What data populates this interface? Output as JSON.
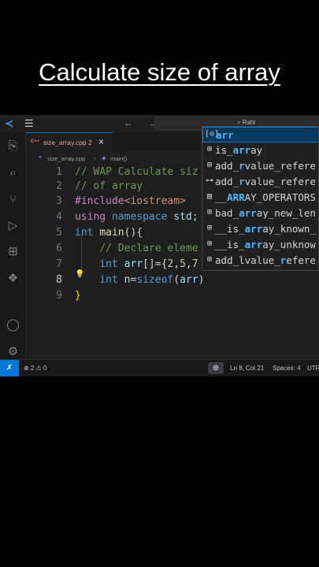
{
  "caption": "Calculate size of array",
  "titlebar": {
    "menu_icon": "☰",
    "search_text": "⌕ Rahi",
    "back_forward": "← →"
  },
  "activity_bar": [
    {
      "name": "explorer-icon",
      "glyph": "⎘"
    },
    {
      "name": "search-icon",
      "glyph": "⌕"
    },
    {
      "name": "source-control-icon",
      "glyph": "⑂"
    },
    {
      "name": "run-debug-icon",
      "glyph": "▷"
    },
    {
      "name": "extensions-icon",
      "glyph": "⊞"
    },
    {
      "name": "python-icon",
      "glyph": "❖"
    },
    {
      "name": "accounts-icon",
      "glyph": "◯"
    },
    {
      "name": "settings-gear-icon",
      "glyph": "⚙"
    }
  ],
  "tab": {
    "label": "size_array.cpp 2",
    "icon": "C++",
    "close": "×"
  },
  "breadcrumb": {
    "file": "size_array.cpp",
    "sep": "›",
    "symbol": "main()"
  },
  "code_lines": [
    {
      "n": "1",
      "parts": [
        {
          "t": "// WAP Calculate siz",
          "c": "cm"
        }
      ]
    },
    {
      "n": "2",
      "parts": [
        {
          "t": "// of array",
          "c": "cm"
        }
      ]
    },
    {
      "n": "3",
      "parts": [
        {
          "t": "#include",
          "c": "pp"
        },
        {
          "t": "<iostream>",
          "c": "inc"
        }
      ]
    },
    {
      "n": "4",
      "parts": [
        {
          "t": "using",
          "c": "pp"
        },
        {
          "t": " ",
          "c": "pl"
        },
        {
          "t": "namespace",
          "c": "kw"
        },
        {
          "t": " std;",
          "c": "id"
        }
      ]
    },
    {
      "n": "5",
      "parts": [
        {
          "t": "int",
          "c": "kw"
        },
        {
          "t": " ",
          "c": "pl"
        },
        {
          "t": "main",
          "c": "fn"
        },
        {
          "t": "(){",
          "c": "pl"
        }
      ]
    },
    {
      "n": "6",
      "parts": [
        {
          "t": "    ",
          "c": "pl"
        },
        {
          "t": "// Declare eleme",
          "c": "cm"
        }
      ]
    },
    {
      "n": "7",
      "parts": [
        {
          "t": "    ",
          "c": "pl"
        },
        {
          "t": "int",
          "c": "kw"
        },
        {
          "t": " ",
          "c": "pl"
        },
        {
          "t": "arr",
          "c": "id"
        },
        {
          "t": "[]={",
          "c": "pl"
        },
        {
          "t": "2",
          "c": "num"
        },
        {
          "t": ",",
          "c": "pl"
        },
        {
          "t": "5",
          "c": "num"
        },
        {
          "t": ",",
          "c": "pl"
        },
        {
          "t": "7",
          "c": "num"
        }
      ]
    },
    {
      "n": "8",
      "parts": [
        {
          "t": "    ",
          "c": "pl"
        },
        {
          "t": "int",
          "c": "kw"
        },
        {
          "t": " ",
          "c": "pl"
        },
        {
          "t": "n",
          "c": "id"
        },
        {
          "t": "=",
          "c": "pl"
        },
        {
          "t": "sizeof",
          "c": "kw"
        },
        {
          "t": "(",
          "c": "pl"
        },
        {
          "t": "arr",
          "c": "id"
        },
        {
          "t": ")",
          "c": "pl"
        }
      ]
    },
    {
      "n": "9",
      "parts": [
        {
          "t": "}",
          "c": "br"
        }
      ]
    }
  ],
  "current_line": "8",
  "suggestions": [
    {
      "icon": "[⊙]",
      "pre": "",
      "match": "arr",
      "post": "",
      "selected": true
    },
    {
      "icon": "⊞",
      "pre": "is_",
      "match": "arr",
      "post": "ay",
      "selected": false
    },
    {
      "icon": "⊞",
      "pre": "add_",
      "match": "r",
      "post": "value_refere",
      "selected": false
    },
    {
      "icon": "⊶",
      "pre": "add_",
      "match": "r",
      "post": "value_refere",
      "selected": false
    },
    {
      "icon": "▤",
      "pre": "__",
      "match": "ARR",
      "post": "AY_OPERATORS",
      "selected": false
    },
    {
      "icon": "⊞",
      "pre": "bad_",
      "match": "arr",
      "post": "ay_new_len",
      "selected": false
    },
    {
      "icon": "⊞",
      "pre": "__is_",
      "match": "arr",
      "post": "ay_known_",
      "selected": false
    },
    {
      "icon": "⊞",
      "pre": "__is_",
      "match": "arr",
      "post": "ay_unknow",
      "selected": false
    },
    {
      "icon": "⊞",
      "pre": "add_lvalue_",
      "match": "r",
      "post": "efere",
      "selected": false
    }
  ],
  "statusbar": {
    "remote": "✗",
    "problems": "⊗ 2 ⚠ 0",
    "zoom": "⊕",
    "position": "Ln 8, Col 21",
    "spaces": "Spaces: 4",
    "encoding": "UTF"
  }
}
